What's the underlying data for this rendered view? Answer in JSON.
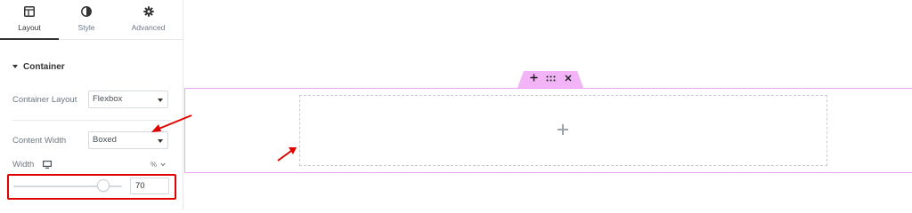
{
  "tabs": [
    {
      "label": "Layout",
      "icon": "columns-icon",
      "active": true
    },
    {
      "label": "Style",
      "icon": "half-circle-icon",
      "active": false
    },
    {
      "label": "Advanced",
      "icon": "gear-icon",
      "active": false
    }
  ],
  "section": {
    "title": "Container",
    "icon": "caret-down-icon"
  },
  "fields": {
    "container_layout": {
      "label": "Container Layout",
      "value": "Flexbox"
    },
    "content_width": {
      "label": "Content Width",
      "value": "Boxed"
    },
    "width": {
      "label": "Width",
      "device_icon": "desktop-icon",
      "unit": "%",
      "value": "70",
      "slider_fraction": 0.7
    }
  },
  "canvas": {
    "handle_icons": [
      "plus-icon",
      "drag-grid-icon",
      "close-icon"
    ],
    "drop_zone_icon": "plus-icon"
  },
  "colors": {
    "accent_highlight": "#e00000",
    "container_border": "#e9a5f0",
    "handle_bg": "#f2b3f7",
    "arrow": "#e00000"
  }
}
